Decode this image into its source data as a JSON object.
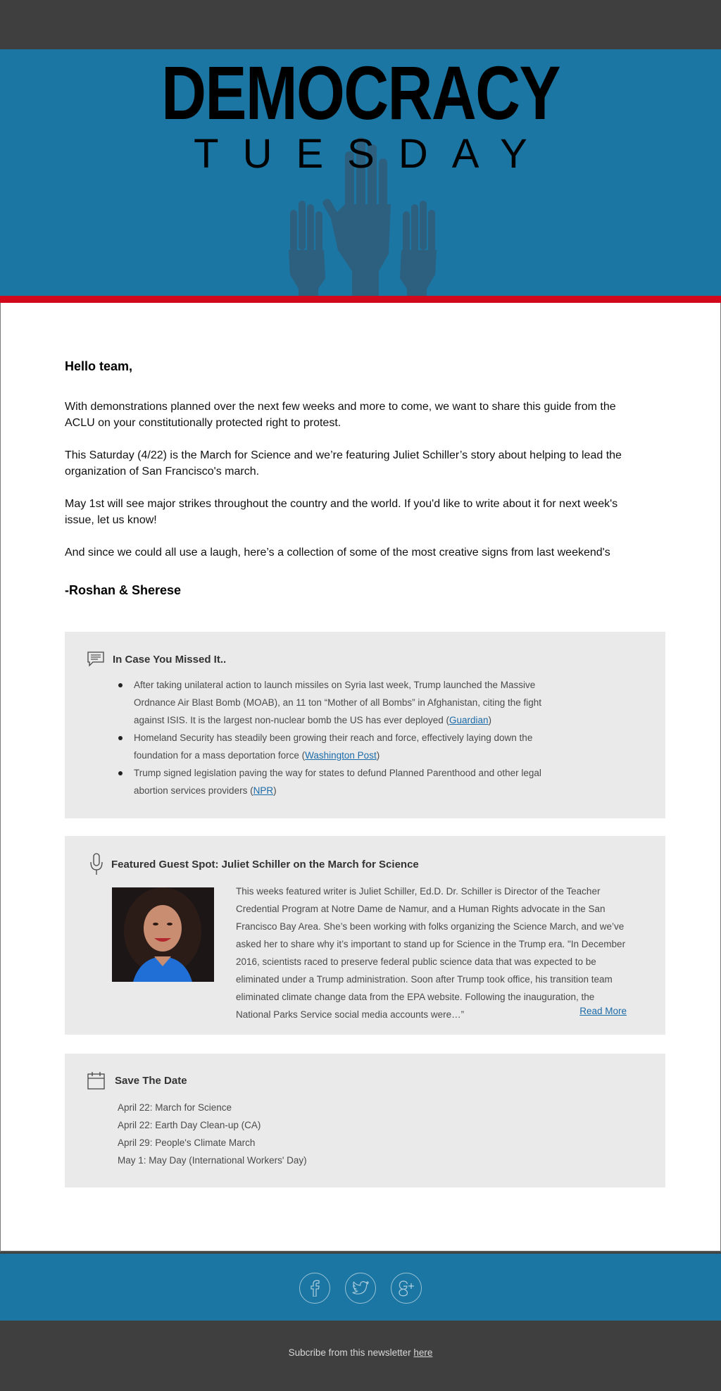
{
  "header": {
    "title": "DEMOCRACY",
    "subtitle": "TUESDAY",
    "logo_icon": "raised-hands-icon",
    "colors": {
      "banner": "#1b76a3",
      "accent_bar": "#d2081d",
      "dark": "#3f3f3f"
    }
  },
  "intro": {
    "greeting": "Hello team,",
    "paragraphs": [
      "With demonstrations planned over the next few weeks and more to come, we want to share this guide from the ACLU on your constitutionally protected right to protest.",
      "This Saturday (4/22) is the March for Science and we’re featuring Juliet Schiller’s story about helping to lead the organization of San Francisco's march.",
      "May 1st will see major strikes throughout the country and the world. If you'd like to write about it for next week's issue, let us know!",
      "And since we could all use a laugh, here’s a collection of some of the most creative signs from last weekend's"
    ],
    "signoff": "-Roshan & Sherese"
  },
  "missed": {
    "title": "In Case You Missed It..",
    "icon": "chat-bubble-icon",
    "items": [
      {
        "text": "After taking unilateral action to launch missiles on Syria last week, Trump launched the Massive Ordnance Air Blast Bomb (MOAB), an 11 ton “Mother of all Bombs” in Afghanistan, citing the fight against ISIS. It is the largest non-nuclear bomb the US has ever deployed (",
        "source": "Guardian",
        "end": ")"
      },
      {
        "text": "Homeland Security has steadily been growing their reach and force, effectively laying down the foundation for a mass deportation force (",
        "source": "Washington Post",
        "end": ")"
      },
      {
        "text": "Trump signed legislation paving the way for states to defund Planned Parenthood and other legal abortion services providers (",
        "source": "NPR",
        "end": ")"
      }
    ]
  },
  "guest": {
    "title": "Featured Guest Spot: Juliet Schiller on the March for Science",
    "icon": "microphone-icon",
    "body": "This weeks featured writer is Juliet Schiller, Ed.D. Dr. Schiller is Director of the Teacher Credential Program at Notre Dame de Namur, and a Human Rights advocate in the San Francisco Bay Area. She’s been working with folks organizing the Science March, and we’ve asked her to share why it’s important to stand up for Science in the Trump era. \"In December 2016, scientists raced to preserve federal public science data that was expected to be eliminated under a Trump administration. Soon after Trump took office, his transition team eliminated climate change data from the EPA website. Following the inauguration, the National Parks Service social media  accounts were…”",
    "read_more": "Read More"
  },
  "save_date": {
    "title": "Save The Date",
    "icon": "calendar-icon",
    "dates": [
      "April 22: March for Science",
      "April 22: Earth Day Clean-up (CA)",
      "April 29: People's Climate March",
      "May 1: May Day (International Workers' Day)"
    ]
  },
  "footer": {
    "social_icons": [
      "facebook-icon",
      "twitter-icon",
      "google-plus-icon"
    ],
    "unsubscribe_text": "Subcribe from this newsletter",
    "unsubscribe_link": "here"
  }
}
